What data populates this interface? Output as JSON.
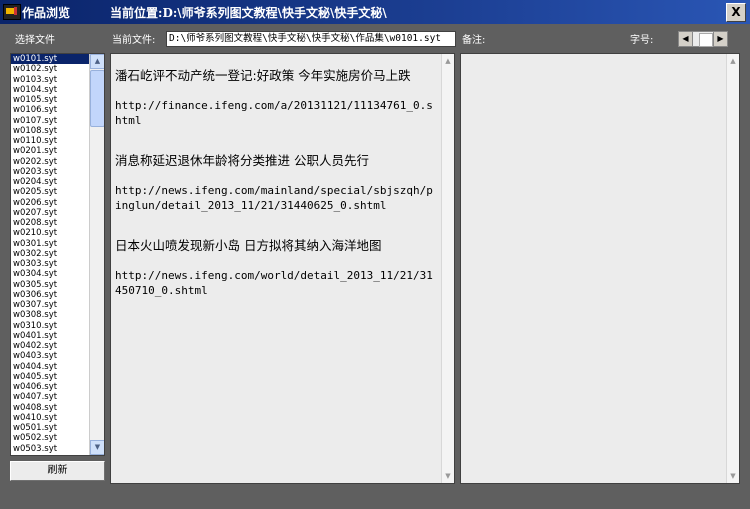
{
  "window": {
    "title": "作品浏览",
    "location_label": "当前位置:",
    "location_path": "D:\\师爷系列图文教程\\快手文秘\\快手文秘\\",
    "close_glyph": "X"
  },
  "toolbar": {
    "select_file_label": "选择文件",
    "current_file_label": "当前文件:",
    "current_file_value": "D:\\师爷系列图文教程\\快手文秘\\快手文秘\\作品集\\w0101.syt",
    "notes_label": "备注:",
    "font_size_label": "字号:",
    "font_size_left": "◀",
    "font_size_right": "▶"
  },
  "file_list": {
    "selected": "w0101.syt",
    "items": [
      "w0101.syt",
      "w0102.syt",
      "w0103.syt",
      "w0104.syt",
      "w0105.syt",
      "w0106.syt",
      "w0107.syt",
      "w0108.syt",
      "w0110.syt",
      "w0201.syt",
      "w0202.syt",
      "w0203.syt",
      "w0204.syt",
      "w0205.syt",
      "w0206.syt",
      "w0207.syt",
      "w0208.syt",
      "w0210.syt",
      "w0301.syt",
      "w0302.syt",
      "w0303.syt",
      "w0304.syt",
      "w0305.syt",
      "w0306.syt",
      "w0307.syt",
      "w0308.syt",
      "w0310.syt",
      "w0401.syt",
      "w0402.syt",
      "w0403.syt",
      "w0404.syt",
      "w0405.syt",
      "w0406.syt",
      "w0407.syt",
      "w0408.syt",
      "w0410.syt",
      "w0501.syt",
      "w0502.syt",
      "w0503.syt"
    ],
    "scroll_up": "▲",
    "scroll_down": "▼"
  },
  "refresh_label": "刷新",
  "content": {
    "blocks": [
      {
        "headline": "潘石屹评不动产统一登记:好政策 今年实施房价马上跌",
        "url": "http://finance.ifeng.com/a/20131121/11134761_0.shtml"
      },
      {
        "headline": "消息称延迟退休年龄将分类推进 公职人员先行",
        "url": "http://news.ifeng.com/mainland/special/sbjszqh/pinglun/detail_2013_11/21/31440625_0.shtml"
      },
      {
        "headline": "日本火山喷发现新小岛 日方拟将其纳入海洋地图",
        "url": "http://news.ifeng.com/world/detail_2013_11/21/31450710_0.shtml"
      }
    ],
    "scroll_up": "▲",
    "scroll_down": "▼"
  },
  "notes": {
    "text": "",
    "scroll_up": "▲",
    "scroll_down": "▼"
  }
}
